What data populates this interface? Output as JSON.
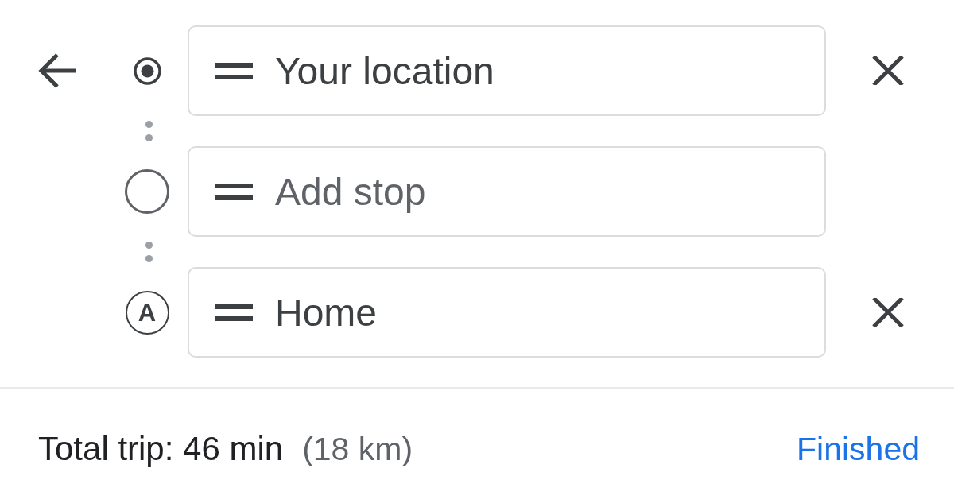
{
  "stops": [
    {
      "kind": "origin",
      "value": "Your location",
      "removable": true
    },
    {
      "kind": "stop",
      "placeholder": "Add stop",
      "removable": false
    },
    {
      "kind": "destination",
      "marker_label": "A",
      "value": "Home",
      "removable": true
    }
  ],
  "summary": {
    "duration": "Total trip: 46 min",
    "distance": "(18 km)"
  },
  "finish_button": {
    "label": "Finished"
  }
}
